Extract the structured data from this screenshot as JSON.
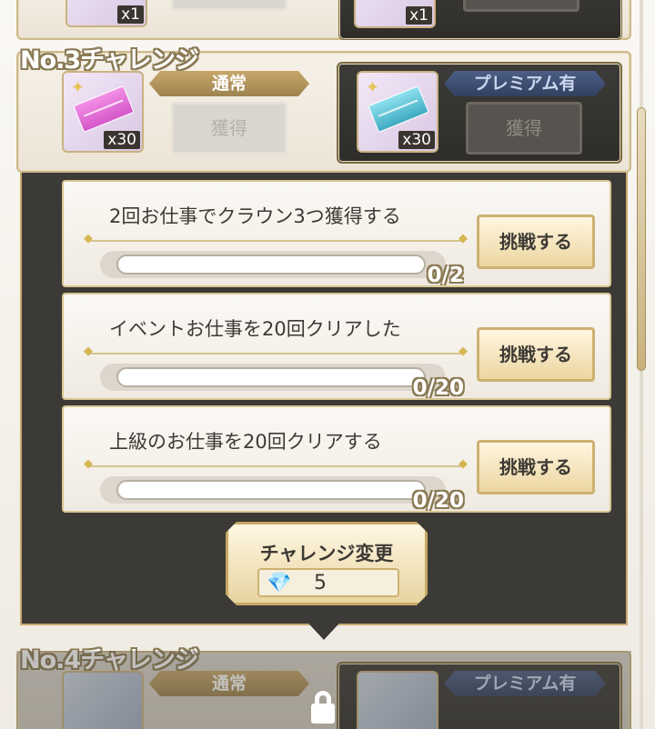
{
  "top_row": {
    "left_qty": "x1",
    "right_qty": "x1"
  },
  "challenge3": {
    "title": "No.3チャレンジ",
    "normal": {
      "tag": "通常",
      "qty": "x30",
      "button": "獲得"
    },
    "premium": {
      "tag": "プレミアム有",
      "qty": "x30",
      "button": "獲得"
    }
  },
  "missions": [
    {
      "text": "2回お仕事でクラウン3つ獲得する",
      "count": "0/2",
      "progress": 0,
      "button": "挑戦する"
    },
    {
      "text": "イベントお仕事を20回クリアした",
      "count": "0/20",
      "progress": 0,
      "button": "挑戦する"
    },
    {
      "text": "上級のお仕事を20回クリアする",
      "count": "0/20",
      "progress": 0,
      "button": "挑戦する"
    }
  ],
  "change": {
    "label": "チャレンジ変更",
    "cost": "5",
    "cost_icon": "diamond-icon"
  },
  "challenge4": {
    "title": "No.4チャレンジ",
    "normal_tag": "通常",
    "premium_tag": "プレミアム有",
    "locked": true
  },
  "colors": {
    "gold": "#c8ac6e",
    "panel": "#3c3a37",
    "premium": "#33405f"
  }
}
